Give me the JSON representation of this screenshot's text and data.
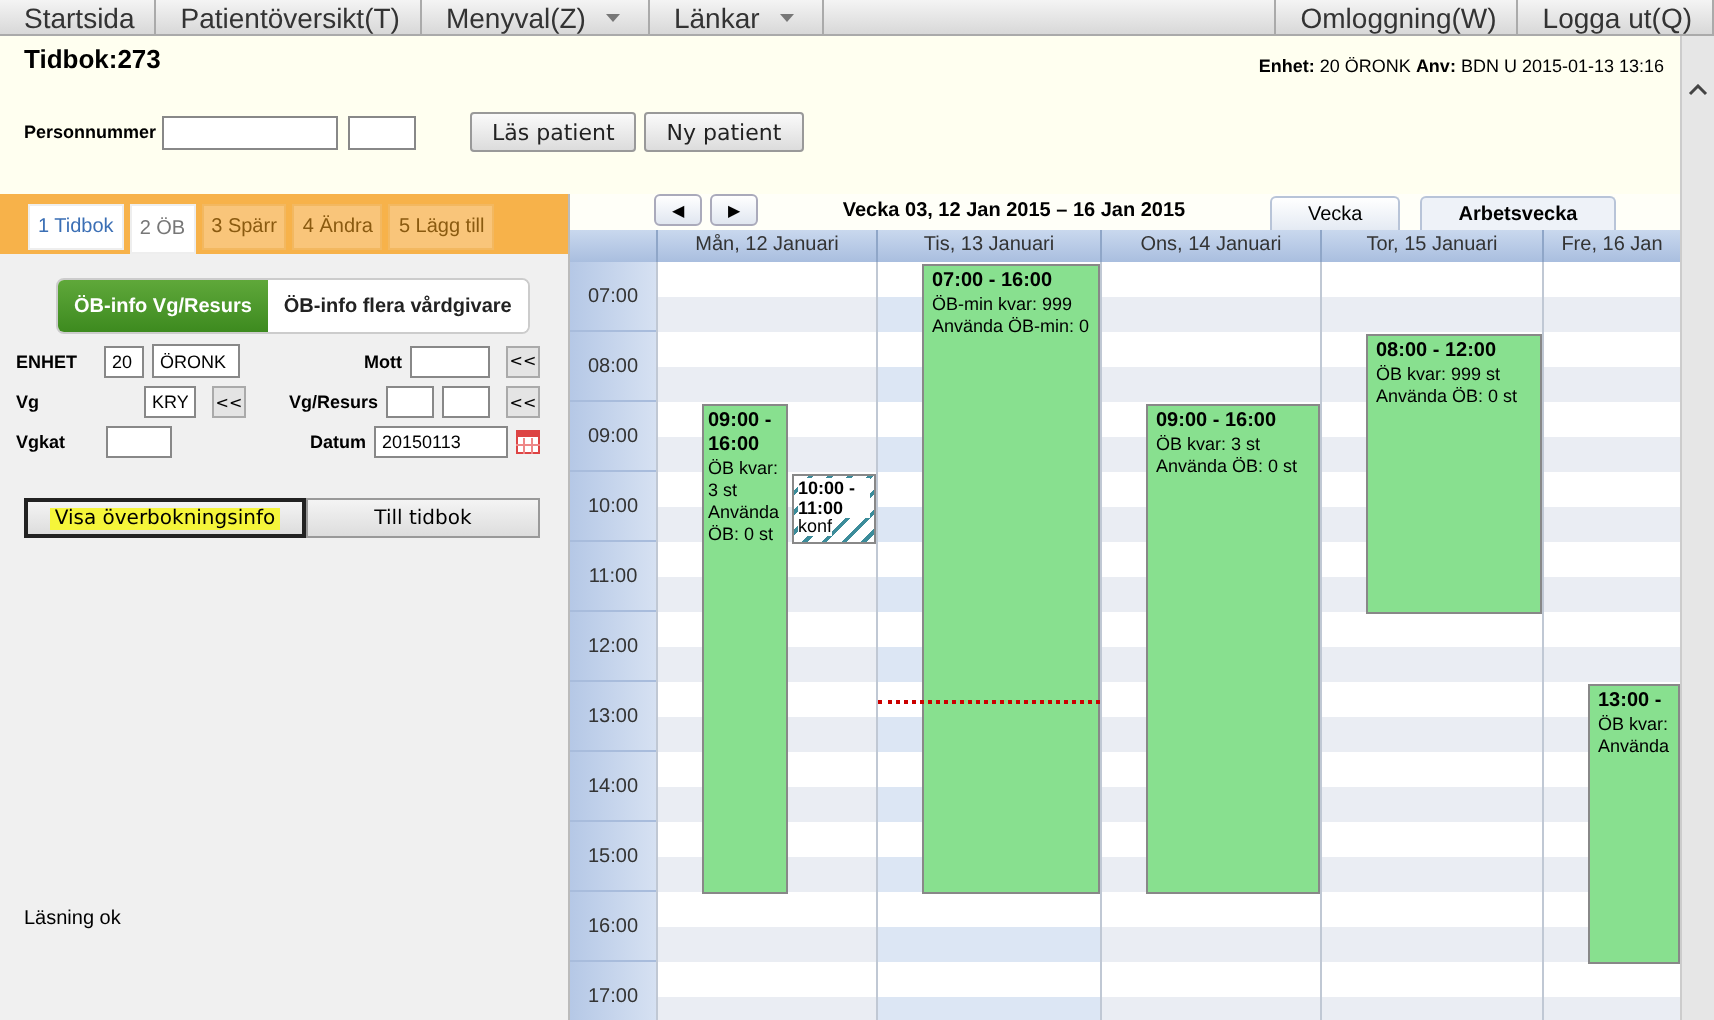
{
  "menu": {
    "left": [
      {
        "label": "Startsida",
        "dropdown": false
      },
      {
        "label": "Patientöversikt(T)",
        "dropdown": false
      },
      {
        "label": "Menyval(Z)",
        "dropdown": true
      },
      {
        "label": "Länkar",
        "dropdown": true
      }
    ],
    "right": [
      {
        "label": "Omloggning(W)",
        "dropdown": false
      },
      {
        "label": "Logga ut(Q)",
        "dropdown": false
      }
    ]
  },
  "header": {
    "title": "Tidbok:273",
    "info": "**Enhet:** 20 ÖRONK **Anv:** BDN  U  2015-01-13 13:16",
    "personnummer_label": "Personnummer",
    "buttons": [
      "Läs patient",
      "Ny patient"
    ]
  },
  "tabs": [
    {
      "label": "1 Tidbok",
      "selected": false,
      "disabled": false
    },
    {
      "label": "2 ÖB",
      "selected": true,
      "disabled": false
    },
    {
      "label": "3 Spärr",
      "selected": false,
      "disabled": true
    },
    {
      "label": "4 Ändra",
      "selected": false,
      "disabled": true
    },
    {
      "label": "5 Lägg till",
      "selected": false,
      "disabled": true
    }
  ],
  "segments": [
    {
      "label": "ÖB-info Vg/Resurs",
      "selected": true
    },
    {
      "label": "ÖB-info flera vårdgivare",
      "selected": false
    }
  ],
  "form": {
    "enhet_label": "ENHET",
    "enhet_code": "20",
    "enhet_name": "ÖRONK",
    "mott_label": "Mott",
    "vg_label": "Vg",
    "vg_value": "KRY",
    "vgresurs_label": "Vg/Resurs",
    "vgkat_label": "Vgkat",
    "datum_label": "Datum",
    "datum_value": "20150113",
    "picker": "<<"
  },
  "actions": [
    {
      "label": "Visa överbokningsinfo",
      "focused": true
    },
    {
      "label": "Till tidbok",
      "focused": false
    }
  ],
  "status": "Läsning ok",
  "calendar": {
    "nav": [
      "◀",
      "▶"
    ],
    "title": "Vecka 03, 12 Jan 2015 – 16 Jan 2015",
    "views": [
      {
        "label": "Vecka",
        "selected": false
      },
      {
        "label": "Arbetsvecka",
        "selected": true
      }
    ],
    "hours": [
      "07:00",
      "08:00",
      "09:00",
      "10:00",
      "11:00",
      "12:00",
      "13:00",
      "14:00",
      "15:00",
      "16:00",
      "17:00"
    ],
    "days": [
      {
        "label": "Mån, 12 Januari",
        "today": false,
        "events": [
          {
            "kind": "open",
            "time": "09:00 - 16:00",
            "lines": [
              "ÖB kvar: 3 st",
              "Använda ÖB: 0 st"
            ]
          },
          {
            "kind": "conf",
            "time": "10:00 - 11:00",
            "lines": [
              "konf"
            ]
          }
        ]
      },
      {
        "label": "Tis, 13 Januari",
        "today": true,
        "events": [
          {
            "kind": "open",
            "time": "07:00 - 16:00",
            "lines": [
              "ÖB-min kvar: 999",
              "Använda ÖB-min: 0"
            ]
          }
        ]
      },
      {
        "label": "Ons, 14 Januari",
        "today": false,
        "events": [
          {
            "kind": "open",
            "time": "09:00 - 16:00",
            "lines": [
              "ÖB kvar: 3 st",
              "Använda ÖB: 0 st"
            ]
          }
        ]
      },
      {
        "label": "Tor, 15 Januari",
        "today": false,
        "events": [
          {
            "kind": "open",
            "time": "08:00 - 12:00",
            "lines": [
              "ÖB kvar: 999 st",
              "Använda ÖB: 0 st"
            ]
          }
        ]
      },
      {
        "label": "Fre, 16 Jan",
        "today": false,
        "events": [
          {
            "kind": "open",
            "time": "13:00 -",
            "lines": [
              "ÖB kvar:",
              "Använda"
            ]
          }
        ]
      }
    ]
  }
}
